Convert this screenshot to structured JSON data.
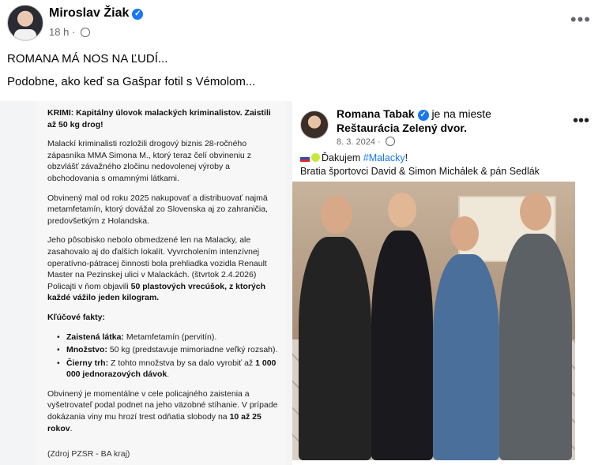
{
  "post": {
    "author": "Miroslav Žiak",
    "time": "18 h",
    "separator": "·",
    "line1": "ROMANA MÁ NOS NA ĽUDÍ...",
    "line2": "Podobne, ako keď sa Gašpar fotil s Vémolom..."
  },
  "left_doc": {
    "title": "KRIMI: Kapitálny úlovok malackých kriminalistov. Zaistili až 50 kg drog!",
    "p1": "Malackí kriminalisti rozložili drogový biznis 28-ročného zápasníka MMA Simona M., ktorý teraz čelí obvineniu z obzvlášť závažného zločinu nedovolenej výroby a obchodovania s omamnými látkami.",
    "p2": "Obvinený mal od roku 2025 nakupovať a distribuovať najmä metamfetamín, ktorý dovážal zo Slovenska aj zo zahraničia, predovšetkým z Holandska.",
    "p3a": "Jeho pôsobisko nebolo obmedzené len na Malacky, ale zasahovalo aj do ďalších lokalít. Vyvrcholením intenzívnej operatívno-pátracej činnosti bola prehliadka vozidla Renault Master na Pezinskej ulici v Malackách. (štvrtok 2.4.2026) Policajti v ňom objavili ",
    "p3b": "50 plastových vrecúšok, z ktorých každé vážilo jeden kilogram.",
    "facts_title": "Kľúčové fakty:",
    "f1_label": "Zaistená látka:",
    "f1_value": " Metamfetamín (pervitín).",
    "f2_label": "Množstvo:",
    "f2_value": " 50 kg (predstavuje mimoriadne veľký rozsah).",
    "f3_label": "Čierny trh:",
    "f3_value": " Z tohto množstva by sa dalo vyrobiť až ",
    "f3_bold": "1 000 000 jednorazových dávok",
    "f3_end": ".",
    "p4a": "Obvinený je momentálne v cele policajného zaistenia a vyšetrovateľ podal podnet na jeho väzobné stíhanie. V prípade dokázania viny mu hrozí trest odňatia slobody na ",
    "p4b": "10 až 25 rokov",
    "p4c": ".",
    "source": "(Zdroj PZSR - BA kraj)"
  },
  "right_post": {
    "author": "Romana Tabak",
    "location_prefix": "je na mieste",
    "location": "Reštaurácia Zelený dvor.",
    "date": "8. 3. 2024 ·",
    "text1_pre": "Ďakujem ",
    "hashtag": "#Malacky",
    "text1_post": "!",
    "text2": "Bratia športovci David & Simon Michálek & pán Sedlák"
  },
  "icons": {
    "verified": "verified-badge-icon",
    "globe": "globe-icon",
    "more": "more-options-icon",
    "flag": "slovakia-flag-icon",
    "ball": "tennis-ball-icon"
  }
}
